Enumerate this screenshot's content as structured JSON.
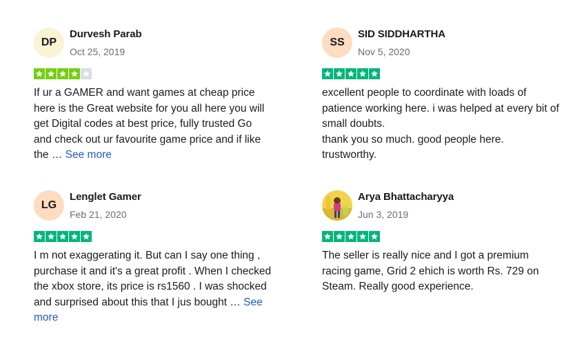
{
  "reviews": [
    {
      "initials": "DP",
      "avatar_color": "#faf3d6",
      "name": "Durvesh Parab",
      "date": "Oct 25, 2019",
      "rating": 4,
      "text": [
        "If ur a GAMER and want games at cheap price here is the Great website for you all here you will get Digital codes at best price, fully trusted Go and check out ur favourite game price and if like the …"
      ],
      "see_more": "See more"
    },
    {
      "initials": "SS",
      "avatar_color": "#fddcc2",
      "name": "SID SIDDHARTHA",
      "date": "Nov 5, 2020",
      "rating": 5,
      "text": [
        "excellent people to coordinate with loads of patience working here. i was helped at every bit of small doubts.",
        "thank you so much. good people here. trustworthy."
      ],
      "see_more": ""
    },
    {
      "initials": "LG",
      "avatar_color": "#fddcc2",
      "name": "Lenglet Gamer",
      "date": "Feb 21, 2020",
      "rating": 5,
      "text": [
        "I m not exaggerating it. But can I say one thing , purchase it and it's a great profit . When I checked the xbox store, its price is rs1560 . I was shocked and surprised about this that I jus bought …"
      ],
      "see_more": "See more"
    },
    {
      "initials": "",
      "avatar_color": "#f2d34a",
      "avatar_photo": true,
      "name": "Arya Bhattacharyya",
      "date": "Jun 3, 2019",
      "rating": 5,
      "text": [
        "The seller is really nice and I got a premium racing game, Grid 2 ehich is worth Rs. 729 on Steam. Really good experience."
      ],
      "see_more": ""
    }
  ],
  "colors": {
    "star_full": "#00b67a",
    "star_four": "#73cf11",
    "star_empty": "#dcdce6",
    "link": "#1e58c8"
  }
}
